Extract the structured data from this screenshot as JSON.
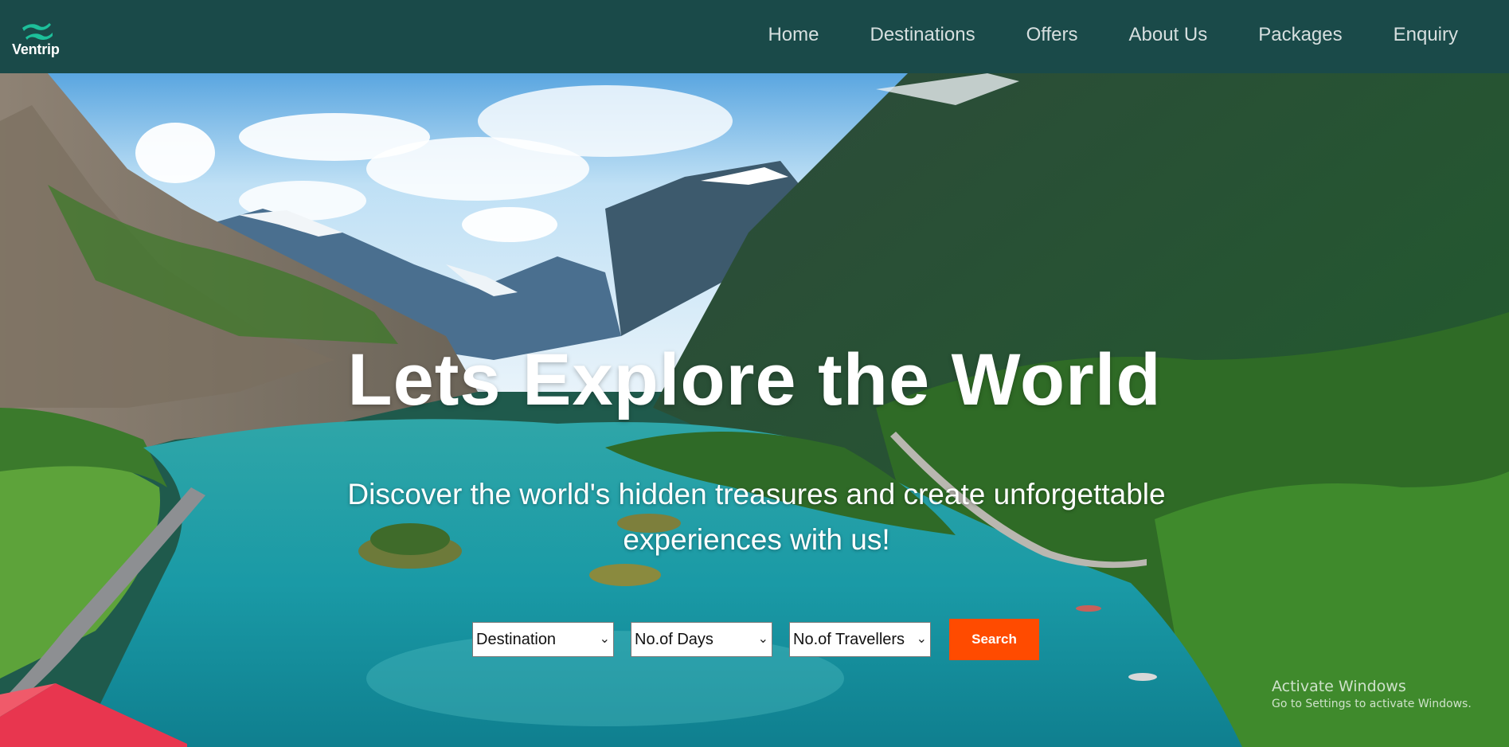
{
  "brand": {
    "name": "Ventrip",
    "logo_icon": "wave-logo-icon",
    "accent": "#1dbf9a"
  },
  "nav": {
    "items": [
      "Home",
      "Destinations",
      "Offers",
      "About Us",
      "Packages",
      "Enquiry"
    ],
    "background": "#1a4a49"
  },
  "hero": {
    "title": "Lets Explore the World",
    "subtitle": "Discover the world's hidden treasures and create unforgettable experiences with us!",
    "filters": {
      "destination": "Destination",
      "days": "No.of Days",
      "travellers": "No.of Travellers"
    },
    "search_label": "Search",
    "search_color": "#ff4b00"
  },
  "watermark": {
    "line1": "Activate Windows",
    "line2": "Go to Settings to activate Windows."
  }
}
